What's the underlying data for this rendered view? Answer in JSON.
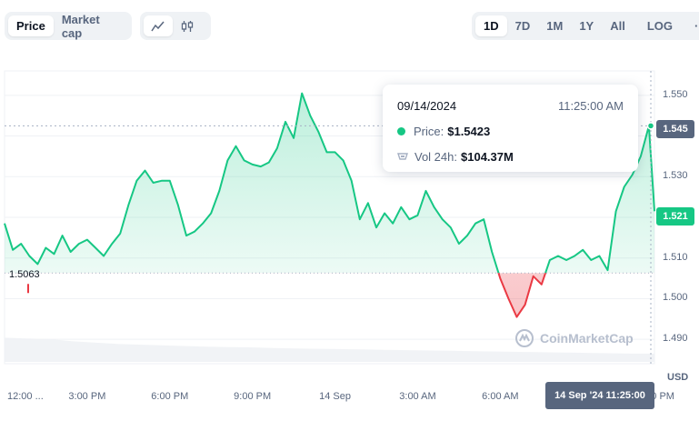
{
  "tabs": {
    "price": "Price",
    "market_cap": "Market cap"
  },
  "chart_type_icons": [
    "line-chart-icon",
    "candlestick-icon"
  ],
  "ranges": [
    "1D",
    "7D",
    "1M",
    "1Y",
    "All",
    "LOG",
    "···"
  ],
  "active_range": "1D",
  "tooltip": {
    "date": "09/14/2024",
    "time": "11:25:00 AM",
    "price_label": "Price:",
    "price_value": "$1.5423",
    "vol_label": "Vol 24h:",
    "vol_value": "$104.37M"
  },
  "open_label": "1.5063",
  "current_price_tag": "1.545",
  "hover_price_tag": "1.521",
  "hover_date": "14 Sep '24 11:25:00",
  "currency": "USD",
  "watermark": "CoinMarketCap",
  "colors": {
    "up": "#16c784",
    "down": "#ea3943",
    "accent_tag": "#58667e"
  },
  "chart_data": {
    "type": "area",
    "title": "",
    "xlabel": "",
    "ylabel": "",
    "ylim": [
      1.484,
      1.556
    ],
    "y_ticks": [
      1.55,
      1.54,
      1.53,
      1.52,
      1.51,
      1.5,
      1.49
    ],
    "y_tick_labels": [
      "1.550",
      "1.540",
      "1.530",
      "1.520",
      "1.510",
      "1.500",
      "1.490"
    ],
    "x_tick_labels": [
      "12:00 ...",
      "3:00 PM",
      "6:00 PM",
      "9:00 PM",
      "14 Sep",
      "3:00 AM",
      "6:00 AM",
      ":00 PM"
    ],
    "x_tick_hours": [
      0.25,
      3,
      6,
      9,
      12,
      15,
      18,
      23.75
    ],
    "baseline": 1.5063,
    "time_range_hours": [
      0,
      23.6
    ],
    "series": [
      {
        "x_hours": [
          0,
          0.3,
          0.6,
          0.9,
          1.2,
          1.5,
          1.8,
          2.1,
          2.4,
          2.7,
          3.0,
          3.3,
          3.6,
          3.9,
          4.2,
          4.5,
          4.8,
          5.1,
          5.4,
          5.7,
          6.0,
          6.3,
          6.6,
          6.9,
          7.2,
          7.5,
          7.8,
          8.1,
          8.4,
          8.7,
          9.0,
          9.3,
          9.6,
          9.9,
          10.2,
          10.5,
          10.8,
          11.1,
          11.4,
          11.7,
          12.0,
          12.3,
          12.6,
          12.9,
          13.2,
          13.5,
          13.8,
          14.1,
          14.4,
          14.7,
          15.0,
          15.3,
          15.6,
          15.9,
          16.2,
          16.5,
          16.8,
          17.1,
          17.4,
          17.7,
          18.0,
          18.3,
          18.6,
          18.9,
          19.2,
          19.5,
          19.8,
          20.1,
          20.4,
          20.7,
          21.0,
          21.3,
          21.6,
          21.9,
          22.2,
          22.5,
          22.8,
          23.1,
          23.4,
          23.6
        ],
        "price": [
          1.5185,
          1.512,
          1.5135,
          1.5105,
          1.5085,
          1.5125,
          1.511,
          1.5155,
          1.5115,
          1.5135,
          1.5145,
          1.5125,
          1.5105,
          1.5135,
          1.516,
          1.523,
          1.529,
          1.5315,
          1.5285,
          1.529,
          1.529,
          1.523,
          1.5155,
          1.5165,
          1.5185,
          1.521,
          1.5265,
          1.534,
          1.5375,
          1.534,
          1.533,
          1.5325,
          1.5335,
          1.537,
          1.5435,
          1.5395,
          1.5505,
          1.545,
          1.541,
          1.536,
          1.536,
          1.534,
          1.529,
          1.5195,
          1.5235,
          1.5175,
          1.521,
          1.5185,
          1.5225,
          1.5195,
          1.5205,
          1.5265,
          1.5225,
          1.5195,
          1.5175,
          1.5135,
          1.5155,
          1.5185,
          1.5195,
          1.5115,
          1.505,
          1.5,
          1.4955,
          1.4985,
          1.5055,
          1.5035,
          1.5095,
          1.5105,
          1.5095,
          1.5105,
          1.512,
          1.5095,
          1.5105,
          1.507,
          1.5215,
          1.5275,
          1.5305,
          1.535,
          1.5425,
          1.5215
        ]
      }
    ],
    "volume_scale_fraction": [
      0.7,
      0.68,
      0.66,
      0.6,
      0.56,
      0.52,
      0.5,
      0.48,
      0.46,
      0.44,
      0.43,
      0.42,
      0.4,
      0.39,
      0.38,
      0.37,
      0.36,
      0.35,
      0.34,
      0.33,
      0.32,
      0.31,
      0.3,
      0.29,
      0.28,
      0.27,
      0.26,
      0.25,
      0.24,
      0.24
    ]
  }
}
